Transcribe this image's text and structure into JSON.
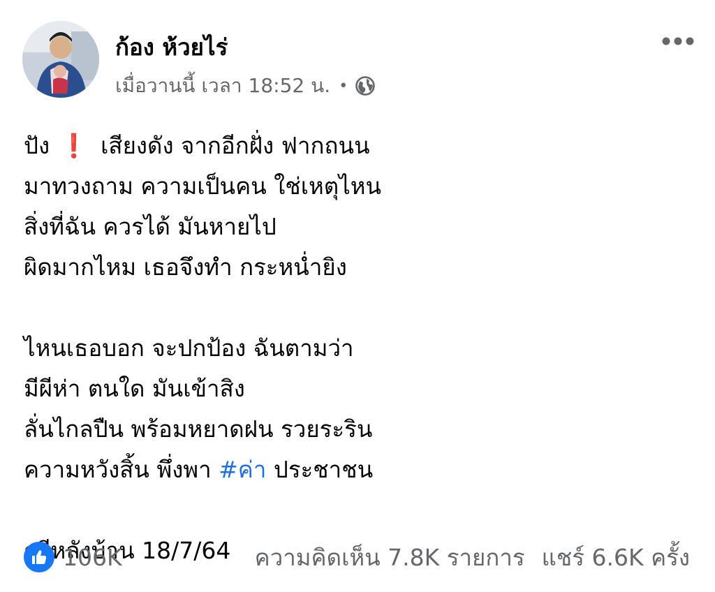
{
  "post": {
    "author": "ก้อง ห้วยไร่",
    "timestamp": "เมื่อวานนี้ เวลา 18:52 น.",
    "separator": "•",
    "privacy_icon": "globe-icon",
    "more_icon": "more-options-icon",
    "lines": [
      {
        "before": "ปัง",
        "icon": "exclamation-icon",
        "icon_text": "❗",
        "after": "เสียงดัง จากอีกฝั่ง ฟากถนน"
      },
      {
        "text": "มาทวงถาม ความเป็นคน ใช่เหตุไหน"
      },
      {
        "text": "สิ่งที่ฉัน ควรได้ มันหายไป"
      },
      {
        "text": "ผิดมากไหม เธอจึงทำ กระหน่ำยิง"
      },
      {
        "text": "ไหนเธอบอก จะปกป้อง ฉันตามว่า"
      },
      {
        "text": "มีผีห่า ตนใด มันเข้าสิง"
      },
      {
        "text": "ลั่นไกลปืน พร้อมหยาดฝน รวยระริน"
      },
      {
        "before": "ความหวังสิ้น พึ่งพา",
        "hashtag": "#ค่า",
        "after": "ประชาชน"
      },
      {
        "text": "กวีหลังบ้าน 18/7/64"
      }
    ],
    "reactions": {
      "icon": "like-icon",
      "count": "106K"
    },
    "comments": "ความคิดเห็น 7.8K รายการ",
    "shares": "แชร์ 6.6K ครั้ง"
  },
  "colors": {
    "text": "#050505",
    "secondary": "#65676b",
    "link": "#216fdb",
    "like": "#1877f2",
    "exclamation": "#e0242b"
  }
}
